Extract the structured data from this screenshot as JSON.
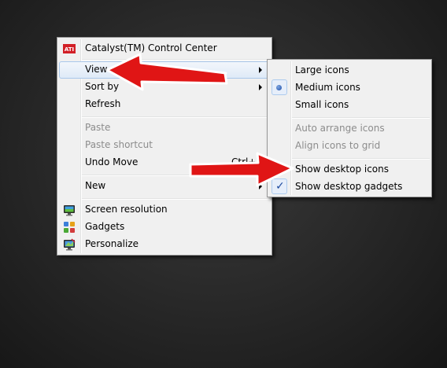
{
  "context_menu": {
    "items": [
      {
        "label": "Catalyst(TM) Control Center"
      },
      {
        "label": "View"
      },
      {
        "label": "Sort by"
      },
      {
        "label": "Refresh"
      },
      {
        "label": "Paste"
      },
      {
        "label": "Paste shortcut"
      },
      {
        "label": "Undo Move",
        "shortcut": "Ctrl+Z"
      },
      {
        "label": "New"
      },
      {
        "label": "Screen resolution"
      },
      {
        "label": "Gadgets"
      },
      {
        "label": "Personalize"
      }
    ],
    "ati_logo_text": "ATI"
  },
  "view_submenu": {
    "items": [
      {
        "label": "Large icons"
      },
      {
        "label": "Medium icons",
        "selected": true
      },
      {
        "label": "Small icons"
      },
      {
        "label": "Auto arrange icons"
      },
      {
        "label": "Align icons to grid"
      },
      {
        "label": "Show desktop icons"
      },
      {
        "label": "Show desktop gadgets",
        "checked": true
      }
    ]
  },
  "colors": {
    "annotation_arrow": "#e01515",
    "menu_background": "#f0f0f0",
    "highlight_border": "#a9c7ea"
  }
}
